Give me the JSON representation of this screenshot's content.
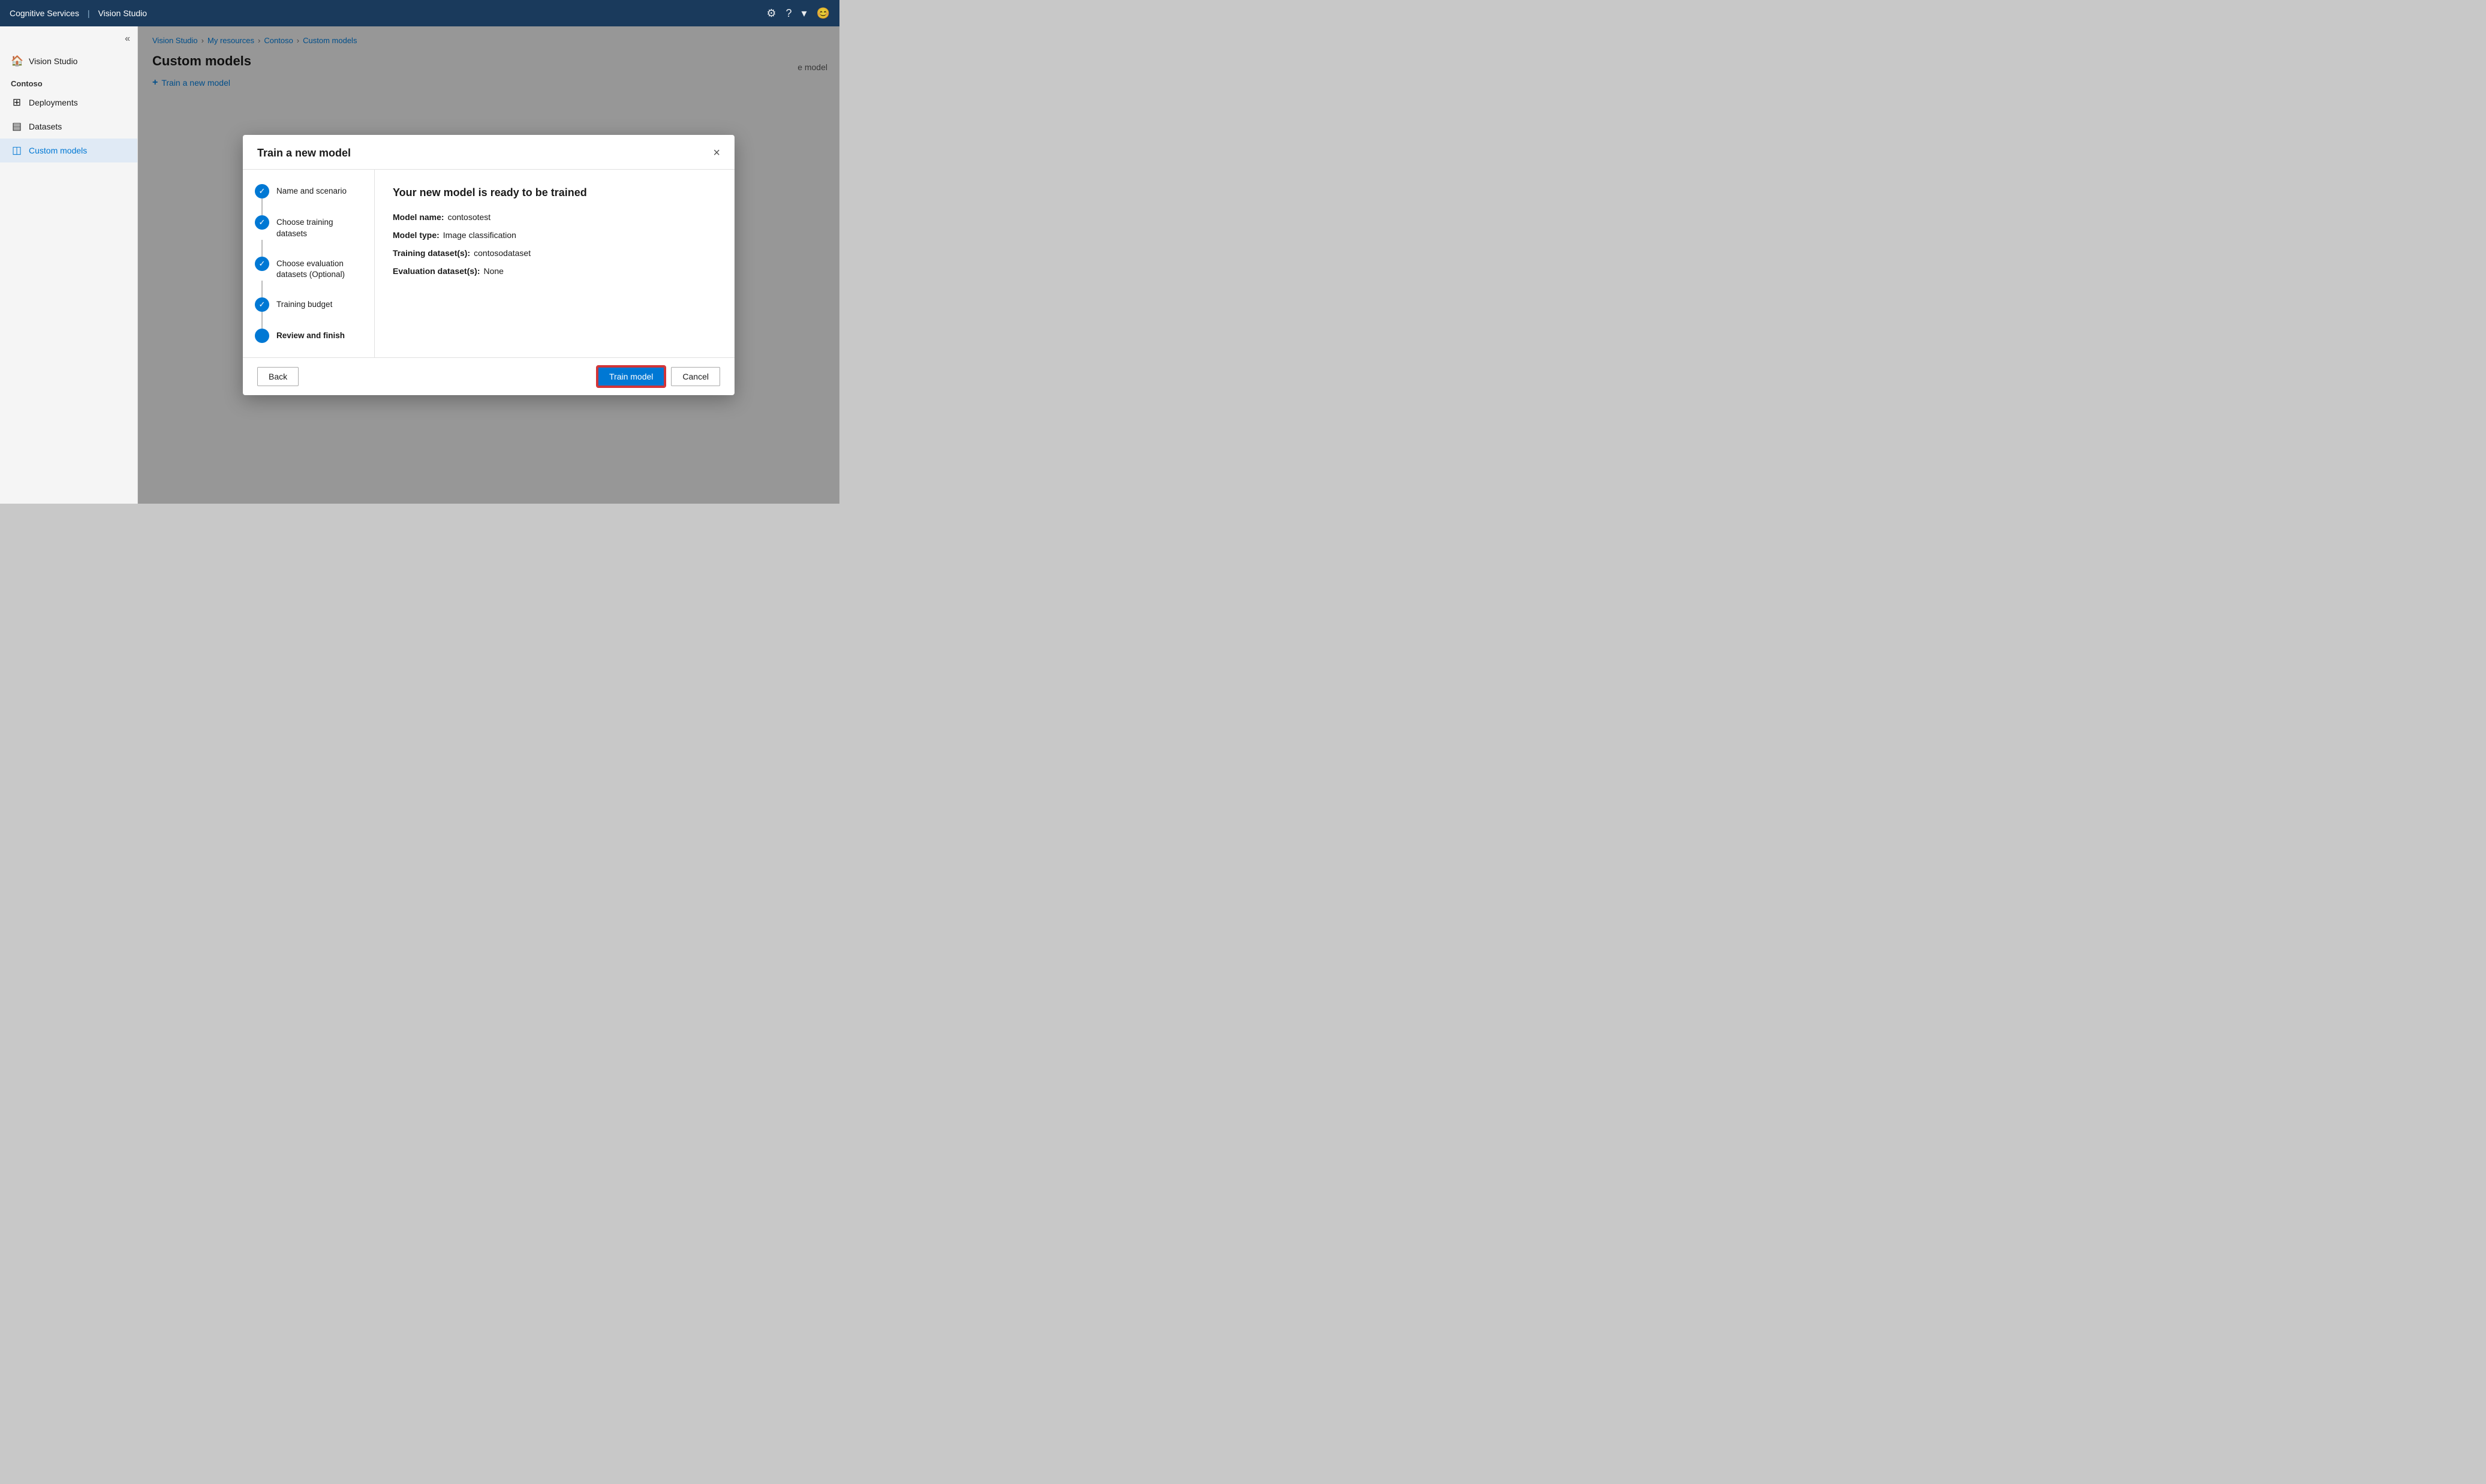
{
  "topbar": {
    "app_name": "Cognitive Services",
    "divider": "|",
    "app_sub": "Vision Studio",
    "icons": {
      "settings": "⚙",
      "help": "?",
      "chevron": "▾",
      "account": "😊"
    }
  },
  "sidebar": {
    "collapse_icon": "«",
    "home_item": "Vision Studio",
    "section_label": "Contoso",
    "items": [
      {
        "id": "deployments",
        "label": "Deployments",
        "icon": "⊞"
      },
      {
        "id": "datasets",
        "label": "Datasets",
        "icon": "▤"
      },
      {
        "id": "custom-models",
        "label": "Custom models",
        "icon": "◫",
        "active": true
      }
    ]
  },
  "breadcrumb": {
    "items": [
      {
        "id": "vision-studio",
        "label": "Vision Studio"
      },
      {
        "id": "my-resources",
        "label": "My resources"
      },
      {
        "id": "contoso",
        "label": "Contoso"
      },
      {
        "id": "custom-models",
        "label": "Custom models"
      }
    ],
    "separator": ">"
  },
  "page": {
    "title": "Custom models",
    "train_button": "Train a new model"
  },
  "modal": {
    "title": "Train a new model",
    "close_label": "×",
    "steps": [
      {
        "id": "name-scenario",
        "label": "Name and scenario",
        "state": "completed"
      },
      {
        "id": "training-datasets",
        "label": "Choose training datasets",
        "state": "completed"
      },
      {
        "id": "evaluation-datasets",
        "label": "Choose evaluation datasets (Optional)",
        "state": "completed"
      },
      {
        "id": "training-budget",
        "label": "Training budget",
        "state": "completed"
      },
      {
        "id": "review-finish",
        "label": "Review and finish",
        "state": "active"
      }
    ],
    "review": {
      "heading": "Your new model is ready to be trained",
      "fields": [
        {
          "label": "Model name:",
          "value": "contosotest"
        },
        {
          "label": "Model type:",
          "value": "Image classification"
        },
        {
          "label": "Training dataset(s):",
          "value": "contosodataset"
        },
        {
          "label": "Evaluation dataset(s):",
          "value": "None"
        }
      ]
    },
    "footer": {
      "back_label": "Back",
      "train_label": "Train model",
      "cancel_label": "Cancel"
    }
  },
  "background": {
    "partial_text": "e model"
  }
}
